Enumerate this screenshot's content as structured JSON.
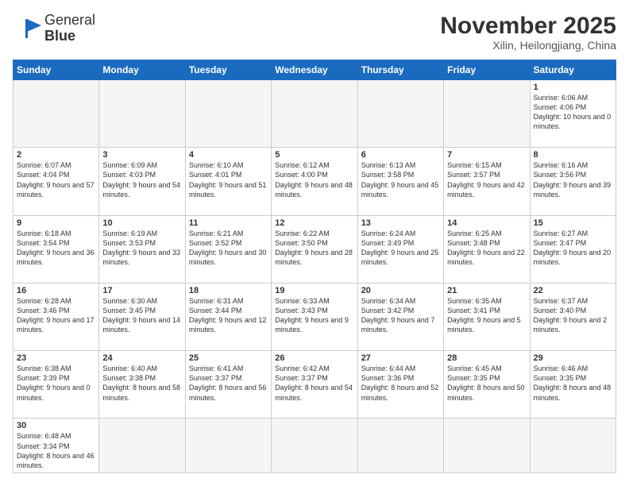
{
  "logo": {
    "text_general": "General",
    "text_blue": "Blue"
  },
  "header": {
    "month": "November 2025",
    "location": "Xilin, Heilongjiang, China"
  },
  "weekdays": [
    "Sunday",
    "Monday",
    "Tuesday",
    "Wednesday",
    "Thursday",
    "Friday",
    "Saturday"
  ],
  "weeks": [
    [
      {
        "day": "",
        "info": ""
      },
      {
        "day": "",
        "info": ""
      },
      {
        "day": "",
        "info": ""
      },
      {
        "day": "",
        "info": ""
      },
      {
        "day": "",
        "info": ""
      },
      {
        "day": "",
        "info": ""
      },
      {
        "day": "1",
        "info": "Sunrise: 6:06 AM\nSunset: 4:06 PM\nDaylight: 10 hours\nand 0 minutes."
      }
    ],
    [
      {
        "day": "2",
        "info": "Sunrise: 6:07 AM\nSunset: 4:04 PM\nDaylight: 9 hours\nand 57 minutes."
      },
      {
        "day": "3",
        "info": "Sunrise: 6:09 AM\nSunset: 4:03 PM\nDaylight: 9 hours\nand 54 minutes."
      },
      {
        "day": "4",
        "info": "Sunrise: 6:10 AM\nSunset: 4:01 PM\nDaylight: 9 hours\nand 51 minutes."
      },
      {
        "day": "5",
        "info": "Sunrise: 6:12 AM\nSunset: 4:00 PM\nDaylight: 9 hours\nand 48 minutes."
      },
      {
        "day": "6",
        "info": "Sunrise: 6:13 AM\nSunset: 3:58 PM\nDaylight: 9 hours\nand 45 minutes."
      },
      {
        "day": "7",
        "info": "Sunrise: 6:15 AM\nSunset: 3:57 PM\nDaylight: 9 hours\nand 42 minutes."
      },
      {
        "day": "8",
        "info": "Sunrise: 6:16 AM\nSunset: 3:56 PM\nDaylight: 9 hours\nand 39 minutes."
      }
    ],
    [
      {
        "day": "9",
        "info": "Sunrise: 6:18 AM\nSunset: 3:54 PM\nDaylight: 9 hours\nand 36 minutes."
      },
      {
        "day": "10",
        "info": "Sunrise: 6:19 AM\nSunset: 3:53 PM\nDaylight: 9 hours\nand 33 minutes."
      },
      {
        "day": "11",
        "info": "Sunrise: 6:21 AM\nSunset: 3:52 PM\nDaylight: 9 hours\nand 30 minutes."
      },
      {
        "day": "12",
        "info": "Sunrise: 6:22 AM\nSunset: 3:50 PM\nDaylight: 9 hours\nand 28 minutes."
      },
      {
        "day": "13",
        "info": "Sunrise: 6:24 AM\nSunset: 3:49 PM\nDaylight: 9 hours\nand 25 minutes."
      },
      {
        "day": "14",
        "info": "Sunrise: 6:25 AM\nSunset: 3:48 PM\nDaylight: 9 hours\nand 22 minutes."
      },
      {
        "day": "15",
        "info": "Sunrise: 6:27 AM\nSunset: 3:47 PM\nDaylight: 9 hours\nand 20 minutes."
      }
    ],
    [
      {
        "day": "16",
        "info": "Sunrise: 6:28 AM\nSunset: 3:46 PM\nDaylight: 9 hours\nand 17 minutes."
      },
      {
        "day": "17",
        "info": "Sunrise: 6:30 AM\nSunset: 3:45 PM\nDaylight: 9 hours\nand 14 minutes."
      },
      {
        "day": "18",
        "info": "Sunrise: 6:31 AM\nSunset: 3:44 PM\nDaylight: 9 hours\nand 12 minutes."
      },
      {
        "day": "19",
        "info": "Sunrise: 6:33 AM\nSunset: 3:43 PM\nDaylight: 9 hours\nand 9 minutes."
      },
      {
        "day": "20",
        "info": "Sunrise: 6:34 AM\nSunset: 3:42 PM\nDaylight: 9 hours\nand 7 minutes."
      },
      {
        "day": "21",
        "info": "Sunrise: 6:35 AM\nSunset: 3:41 PM\nDaylight: 9 hours\nand 5 minutes."
      },
      {
        "day": "22",
        "info": "Sunrise: 6:37 AM\nSunset: 3:40 PM\nDaylight: 9 hours\nand 2 minutes."
      }
    ],
    [
      {
        "day": "23",
        "info": "Sunrise: 6:38 AM\nSunset: 3:39 PM\nDaylight: 9 hours\nand 0 minutes."
      },
      {
        "day": "24",
        "info": "Sunrise: 6:40 AM\nSunset: 3:38 PM\nDaylight: 8 hours\nand 58 minutes."
      },
      {
        "day": "25",
        "info": "Sunrise: 6:41 AM\nSunset: 3:37 PM\nDaylight: 8 hours\nand 56 minutes."
      },
      {
        "day": "26",
        "info": "Sunrise: 6:42 AM\nSunset: 3:37 PM\nDaylight: 8 hours\nand 54 minutes."
      },
      {
        "day": "27",
        "info": "Sunrise: 6:44 AM\nSunset: 3:36 PM\nDaylight: 8 hours\nand 52 minutes."
      },
      {
        "day": "28",
        "info": "Sunrise: 6:45 AM\nSunset: 3:35 PM\nDaylight: 8 hours\nand 50 minutes."
      },
      {
        "day": "29",
        "info": "Sunrise: 6:46 AM\nSunset: 3:35 PM\nDaylight: 8 hours\nand 48 minutes."
      }
    ],
    [
      {
        "day": "30",
        "info": "Sunrise: 6:48 AM\nSunset: 3:34 PM\nDaylight: 8 hours\nand 46 minutes."
      },
      {
        "day": "",
        "info": ""
      },
      {
        "day": "",
        "info": ""
      },
      {
        "day": "",
        "info": ""
      },
      {
        "day": "",
        "info": ""
      },
      {
        "day": "",
        "info": ""
      },
      {
        "day": "",
        "info": ""
      }
    ]
  ]
}
